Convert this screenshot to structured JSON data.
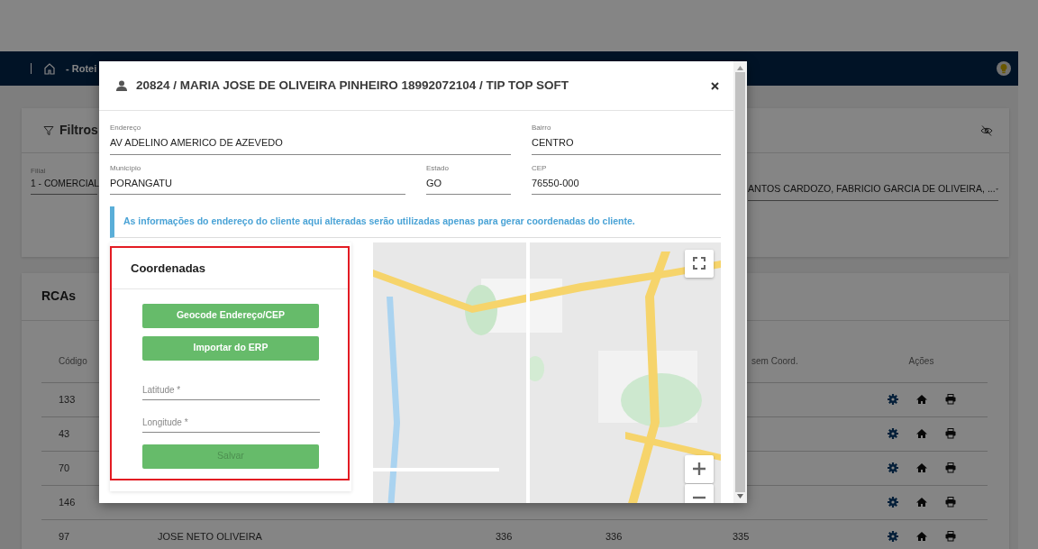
{
  "app": {
    "breadcrumb": "- Rotei"
  },
  "filters": {
    "title": "Filtros",
    "branch_label": "Filial",
    "branch_value": "1 - COMERCIAL",
    "rca_value": "ANTOS CARDOZO, FABRICIO GARCIA DE OLIVEIRA, ..."
  },
  "rcas": {
    "title": "RCAs",
    "columns": {
      "code": "Código",
      "no_coords": "sem Coord.",
      "actions": "Ações"
    },
    "rows": [
      {
        "cells": [
          "133",
          "",
          "",
          "",
          ""
        ]
      },
      {
        "cells": [
          "43",
          "",
          "",
          "",
          ""
        ]
      },
      {
        "cells": [
          "70",
          "",
          "",
          "",
          ""
        ]
      },
      {
        "cells": [
          "146",
          "",
          "",
          "",
          ""
        ]
      },
      {
        "cells": [
          "97",
          "JOSE NETO OLIVEIRA",
          "336",
          "336",
          "335"
        ]
      }
    ]
  },
  "modal": {
    "title": "20824 / MARIA JOSE DE OLIVEIRA PINHEIRO 18992072104 / TIP TOP SOFT",
    "fields": [
      {
        "label": "Endereço",
        "value": "AV ADELINO AMERICO DE AZEVEDO"
      },
      {
        "label": "Bairro",
        "value": "CENTRO"
      },
      {
        "label": "Município",
        "value": "PORANGATU"
      },
      {
        "label": "Estado",
        "value": "GO"
      },
      {
        "label": "CEP",
        "value": "76550-000"
      }
    ],
    "info": "As informações do endereço do cliente aqui alteradas serão utilizadas apenas para gerar coordenadas do cliente.",
    "coordinates": {
      "title": "Coordenadas",
      "actions": [
        {
          "label": "Geocode Endereço/CEP",
          "disabled": false
        },
        {
          "label": "Importar do ERP",
          "disabled": false
        }
      ],
      "inputs": [
        {
          "placeholder": "Latitude *"
        },
        {
          "placeholder": "Longitude *"
        }
      ],
      "save": {
        "label": "Salvar",
        "disabled": true
      }
    }
  }
}
